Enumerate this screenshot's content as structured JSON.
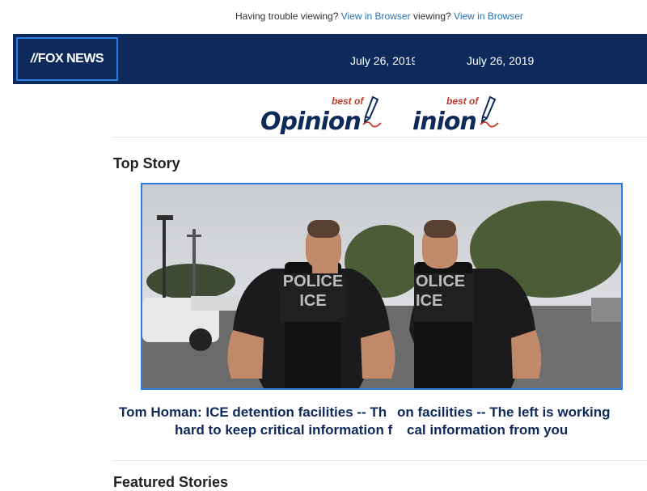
{
  "preheader": {
    "trouble_text": "Having trouble viewing?",
    "view_link": "View in Browser",
    "trouble_text_clipped": "viewing?",
    "view_link_2": "View in Browser"
  },
  "header": {
    "logo_text": "FOX NEWS",
    "logo_slash": "//",
    "date_1": "July 26, 2019",
    "date_2": "July 26, 2019",
    "background": "#0d2a5b",
    "accent": "#2b7de1"
  },
  "opinion_logo": {
    "best_of": "best of",
    "word": "Opinion",
    "word_clipped": "inion"
  },
  "top_story": {
    "section_title": "Top Story",
    "vest_text_line1": "POLICE",
    "vest_text_line2": "ICE",
    "vest_text_clipped_1": "OLICE",
    "vest_text_clipped_2": "ICE",
    "headline_line1_a": "Tom Homan: ICE detention facilities -- Th",
    "headline_line1_b": "on facilities -- The left is working",
    "headline_line2_a": "hard to keep critical information f",
    "headline_line2_b": "cal information from you"
  },
  "featured": {
    "section_title": "Featured Stories"
  },
  "colors": {
    "headline": "#0d2a5b",
    "link": "#2a6fb5",
    "best_of": "#c0392b"
  }
}
